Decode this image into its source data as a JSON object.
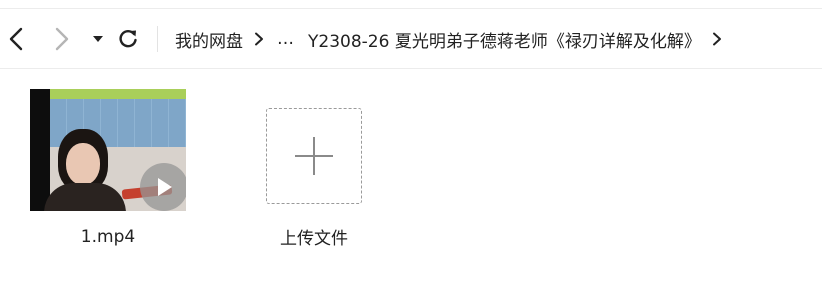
{
  "breadcrumb": {
    "items": [
      "我的网盘",
      "…",
      "Y2308-26 夏光明弟子德蒋老师《禄刃详解及化解》"
    ]
  },
  "files": [
    {
      "name": "1.mp4",
      "type": "video",
      "icon": "play-icon"
    }
  ],
  "upload": {
    "label": "上传文件",
    "icon": "plus-icon"
  },
  "colors": {
    "border": "#ececec",
    "icon": "#222222",
    "disabled_icon": "#b5b5b5",
    "dashed": "#9a9a9a"
  }
}
